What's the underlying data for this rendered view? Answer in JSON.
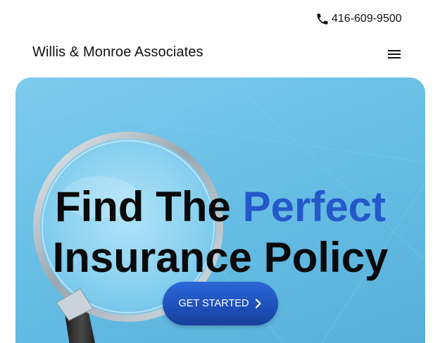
{
  "topbar": {
    "phone": "416-609-9500",
    "phone_icon": "phone-icon"
  },
  "header": {
    "brand": "Willis & Monroe Associates",
    "menu_icon": "hamburger-menu-icon"
  },
  "hero": {
    "title_part1": "Find The ",
    "title_accent": "Perfect",
    "title_part2": "Insurance Policy",
    "cta_label": "GET STARTED",
    "cta_icon": "chevron-right-icon",
    "image": "magnifying-glass-on-blue-background"
  },
  "colors": {
    "accent": "#2459c9",
    "hero_bg": "#6ac0e6",
    "button": "#1d4fb8"
  }
}
